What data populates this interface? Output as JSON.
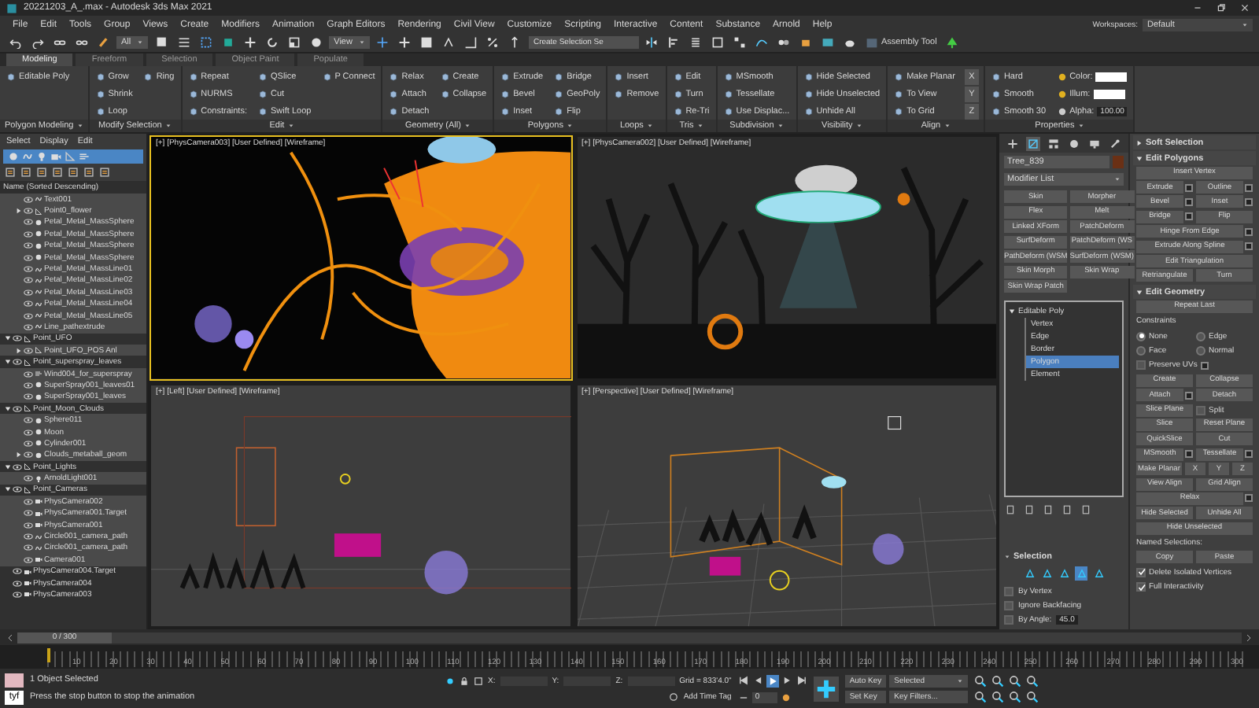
{
  "window": {
    "title": "20221203_A_.max - Autodesk 3ds Max 2021"
  },
  "menu": [
    "File",
    "Edit",
    "Tools",
    "Group",
    "Views",
    "Create",
    "Modifiers",
    "Animation",
    "Graph Editors",
    "Rendering",
    "Civil View",
    "Customize",
    "Scripting",
    "Interactive",
    "Content",
    "Substance",
    "Arnold",
    "Help"
  ],
  "workspaces": {
    "label": "Workspaces:",
    "value": "Default"
  },
  "toolbar": {
    "selection_filter": "All",
    "coordinate_system": "View",
    "named_selection_placeholder": "Create Selection Se",
    "assembly_tool": "Assembly Tool"
  },
  "ribbon_tabs": [
    {
      "label": "Modeling",
      "selected": true
    },
    {
      "label": "Freeform",
      "selected": false
    },
    {
      "label": "Selection",
      "selected": false
    },
    {
      "label": "Object Paint",
      "selected": false
    },
    {
      "label": "Populate",
      "selected": false
    }
  ],
  "ribbon_panels": [
    {
      "title": "Polygon Modeling",
      "items": [
        {
          "label": "Editable Poly"
        }
      ]
    },
    {
      "title": "Modify Selection",
      "items": [
        {
          "label": "Grow"
        },
        {
          "label": "Shrink"
        },
        {
          "label": "Loop"
        },
        {
          "label": "Ring"
        }
      ]
    },
    {
      "title": "Edit",
      "items": [
        {
          "label": "Repeat"
        },
        {
          "label": "NURMS"
        },
        {
          "label": "Constraints:"
        },
        {
          "label": "QSlice"
        },
        {
          "label": "Cut"
        },
        {
          "label": "Swift Loop"
        },
        {
          "label": "P Connect"
        }
      ]
    },
    {
      "title": "Geometry (All)",
      "items": [
        {
          "label": "Relax"
        },
        {
          "label": "Attach"
        },
        {
          "label": "Detach"
        },
        {
          "label": "Create"
        },
        {
          "label": "Collapse"
        }
      ]
    },
    {
      "title": "Polygons",
      "items": [
        {
          "label": "Extrude"
        },
        {
          "label": "Bevel"
        },
        {
          "label": "Inset"
        },
        {
          "label": "Bridge"
        },
        {
          "label": "GeoPoly"
        },
        {
          "label": "Flip"
        }
      ]
    },
    {
      "title": "Loops",
      "items": [
        {
          "label": "Insert"
        },
        {
          "label": "Remove"
        }
      ]
    },
    {
      "title": "Tris",
      "items": [
        {
          "label": "Edit"
        },
        {
          "label": "Turn"
        },
        {
          "label": "Re-Tri"
        }
      ]
    },
    {
      "title": "Subdivision",
      "items": [
        {
          "label": "MSmooth"
        },
        {
          "label": "Tessellate"
        },
        {
          "label": "Use Displac..."
        }
      ]
    },
    {
      "title": "Visibility",
      "items": [
        {
          "label": "Hide Selected"
        },
        {
          "label": "Hide Unselected"
        },
        {
          "label": "Unhide All"
        }
      ]
    },
    {
      "title": "Align",
      "items": [
        {
          "label": "Make Planar"
        },
        {
          "label": "To View"
        },
        {
          "label": "To Grid"
        },
        {
          "label": "X",
          "kind": "axis"
        },
        {
          "label": "Y",
          "kind": "axis"
        },
        {
          "label": "Z",
          "kind": "axis"
        }
      ]
    },
    {
      "title": "Properties",
      "items": [
        {
          "label": "Hard"
        },
        {
          "label": "Smooth"
        },
        {
          "label": "Smooth 30"
        },
        {
          "label": "Color:",
          "kind": "swatch"
        },
        {
          "label": "Illum:",
          "kind": "swatch"
        },
        {
          "label": "Alpha:",
          "kind": "number",
          "value": "100.00"
        }
      ]
    }
  ],
  "scene_explorer": {
    "tabs": [
      "Select",
      "Display",
      "Edit"
    ],
    "header": "Name (Sorted Descending)",
    "continued_children": [
      {
        "name": "Text001",
        "kind": "shape"
      },
      {
        "name": "Point0_flower",
        "kind": "helper",
        "expanded": false
      },
      {
        "name": "Petal_Metal_MassSphere",
        "kind": "geometry"
      },
      {
        "name": "Petal_Metal_MassSphere",
        "kind": "geometry"
      },
      {
        "name": "Petal_Metal_MassSphere",
        "kind": "geometry"
      },
      {
        "name": "Petal_Metal_MassSphere",
        "kind": "geometry"
      },
      {
        "name": "Petal_Metal_MassLine01",
        "kind": "shape"
      },
      {
        "name": "Petal_Metal_MassLine02",
        "kind": "shape"
      },
      {
        "name": "Petal_Metal_MassLine03",
        "kind": "shape"
      },
      {
        "name": "Petal_Metal_MassLine04",
        "kind": "shape"
      },
      {
        "name": "Petal_Metal_MassLine05",
        "kind": "shape"
      },
      {
        "name": "Line_pathextrude",
        "kind": "shape"
      }
    ],
    "roots": [
      {
        "name": "Point_UFO",
        "kind": "helper",
        "expanded": true,
        "children": [
          {
            "name": "Point_UFO_POS Anl",
            "kind": "helper",
            "expanded": false
          }
        ]
      },
      {
        "name": "Point_superspray_leaves",
        "kind": "helper",
        "expanded": true,
        "children": [
          {
            "name": "Wind004_for_superspray",
            "kind": "particles"
          },
          {
            "name": "SuperSpray001_leaves01",
            "kind": "geometry"
          },
          {
            "name": "SuperSpray001_leaves",
            "kind": "geometry"
          }
        ]
      },
      {
        "name": "Point_Moon_Clouds",
        "kind": "helper",
        "expanded": true,
        "children": [
          {
            "name": "Sphere011",
            "kind": "geometry"
          },
          {
            "name": "Moon",
            "kind": "geometry"
          },
          {
            "name": "Cylinder001",
            "kind": "geometry"
          },
          {
            "name": "Clouds_metaball_geom",
            "kind": "geometry",
            "expanded": false
          }
        ]
      },
      {
        "name": "Point_Lights",
        "kind": "helper",
        "expanded": true,
        "children": [
          {
            "name": "ArnoldLight001",
            "kind": "light"
          }
        ]
      },
      {
        "name": "Point_Cameras",
        "kind": "helper",
        "expanded": true,
        "children": [
          {
            "name": "PhysCamera002",
            "kind": "camera"
          },
          {
            "name": "PhysCamera001.Target",
            "kind": "camera"
          },
          {
            "name": "PhysCamera001",
            "kind": "camera"
          },
          {
            "name": "Circle001_camera_path",
            "kind": "shape"
          },
          {
            "name": "Circle001_camera_path",
            "kind": "shape"
          },
          {
            "name": "Camera001",
            "kind": "camera"
          }
        ]
      },
      {
        "name": "PhysCamera004.Target",
        "kind": "camera"
      },
      {
        "name": "PhysCamera004",
        "kind": "camera"
      },
      {
        "name": "PhysCamera003",
        "kind": "camera"
      }
    ]
  },
  "viewports": [
    {
      "label": "[+] [PhysCamera003] [User Defined] [Wireframe]",
      "kind": "render",
      "active": true
    },
    {
      "label": "[+] [PhysCamera002] [User Defined] [Wireframe]",
      "kind": "night",
      "active": false
    },
    {
      "label": "[+] [Left] [User Defined] [Wireframe]",
      "kind": "side",
      "active": false
    },
    {
      "label": "[+] [Perspective] [User Defined] [Wireframe]",
      "kind": "perspective",
      "active": false
    }
  ],
  "command_panel": {
    "tabs": [
      {
        "selected": false
      },
      {
        "selected": true
      },
      {
        "selected": false
      },
      {
        "selected": false
      },
      {
        "selected": false
      },
      {
        "selected": false
      }
    ],
    "object_name": "Tree_839",
    "modifier_list": "Modifier List",
    "modifier_buttons": [
      "Skin",
      "Morpher",
      "Flex",
      "Melt",
      "Linked XForm",
      "PatchDeform",
      "SurfDeform",
      "PatchDeform (WS",
      "PathDeform (WSM",
      "SurfDeform (WSM)",
      "Skin Morph",
      "Skin Wrap",
      "Skin Wrap Patch"
    ],
    "modifier_stack": {
      "name": "Editable Poly",
      "expanded": true,
      "levels": [
        {
          "label": "Vertex",
          "selected": false
        },
        {
          "label": "Edge",
          "selected": false
        },
        {
          "label": "Border",
          "selected": false
        },
        {
          "label": "Polygon",
          "selected": true
        },
        {
          "label": "Element",
          "selected": false
        }
      ]
    },
    "selection_rollout": {
      "title": "Selection",
      "options": [
        {
          "label": "By Vertex",
          "checked": false
        },
        {
          "label": "Ignore Backfacing",
          "checked": false
        },
        {
          "label": "By Angle:",
          "checked": false,
          "value": "45.0"
        }
      ]
    },
    "rollouts": [
      {
        "title": "Soft Selection",
        "expanded": false
      },
      {
        "title": "Edit Polygons",
        "expanded": true,
        "rows": [
          [
            {
              "label": "Insert Vertex"
            }
          ],
          [
            {
              "label": "Extrude",
              "settings": true
            },
            {
              "label": "Outline",
              "settings": true
            }
          ],
          [
            {
              "label": "Bevel",
              "settings": true
            },
            {
              "label": "Inset",
              "settings": true
            }
          ],
          [
            {
              "label": "Bridge",
              "settings": true
            },
            {
              "label": "Flip"
            }
          ],
          [
            {
              "label": "Hinge From Edge",
              "settings": true
            }
          ],
          [
            {
              "label": "Extrude Along Spline",
              "settings": true
            }
          ],
          [
            {
              "label": "Edit Triangulation"
            }
          ],
          [
            {
              "label": "Retriangulate"
            },
            {
              "label": "Turn"
            }
          ]
        ]
      },
      {
        "title": "Edit Geometry",
        "expanded": true,
        "rows": [
          [
            {
              "label": "Repeat Last"
            }
          ],
          [
            {
              "label": "Constraints",
              "kind": "label"
            }
          ],
          [
            {
              "label": "None",
              "kind": "radio",
              "checked": true
            },
            {
              "label": "Edge",
              "kind": "radio",
              "checked": false
            }
          ],
          [
            {
              "label": "Face",
              "kind": "radio",
              "checked": false
            },
            {
              "label": "Normal",
              "kind": "radio",
              "checked": false
            }
          ],
          [
            {
              "label": "Preserve UVs",
              "kind": "checkbox",
              "checked": false,
              "settings": true
            }
          ],
          [
            {
              "label": "Create"
            },
            {
              "label": "Collapse"
            }
          ],
          [
            {
              "label": "Attach",
              "settings": true
            },
            {
              "label": "Detach"
            }
          ],
          [
            {
              "label": "Slice Plane"
            },
            {
              "label": "Split",
              "kind": "checkbox",
              "checked": false
            }
          ],
          [
            {
              "label": "Slice"
            },
            {
              "label": "Reset Plane"
            }
          ],
          [
            {
              "label": "QuickSlice"
            },
            {
              "label": "Cut"
            }
          ],
          [
            {
              "label": "MSmooth",
              "settings": true
            },
            {
              "label": "Tessellate",
              "settings": true
            }
          ],
          [
            {
              "label": "Make Planar"
            },
            {
              "label": "X"
            },
            {
              "label": "Y"
            },
            {
              "label": "Z"
            }
          ],
          [
            {
              "label": "View Align"
            },
            {
              "label": "Grid Align"
            }
          ],
          [
            {
              "label": "Relax",
              "settings": true
            }
          ],
          [
            {
              "label": "Hide Selected"
            },
            {
              "label": "Unhide All"
            }
          ],
          [
            {
              "label": "Hide Unselected"
            }
          ],
          [
            {
              "label": "Named Selections:",
              "kind": "label"
            }
          ],
          [
            {
              "label": "Copy"
            },
            {
              "label": "Paste"
            }
          ],
          [
            {
              "label": "Delete Isolated Vertices",
              "kind": "checkbox",
              "checked": true
            }
          ],
          [
            {
              "label": "Full Interactivity",
              "kind": "checkbox",
              "checked": true
            }
          ]
        ]
      }
    ]
  },
  "time_slider": {
    "label": "0 / 300",
    "level": 0
  },
  "timeline_ticks": [
    "10",
    "20",
    "30",
    "40",
    "50",
    "60",
    "70",
    "80",
    "90",
    "100",
    "110",
    "120",
    "130",
    "140",
    "150",
    "160",
    "170",
    "180",
    "190",
    "200",
    "210",
    "220",
    "230",
    "240",
    "250",
    "260",
    "270",
    "280",
    "290",
    "300"
  ],
  "status": {
    "selection": "1 Object Selected",
    "prompt": "Press the stop button to stop the animation",
    "script_label": "tyf",
    "x_label": "X:",
    "y_label": "Y:",
    "z_label": "Z:",
    "grid": "Grid = 833'4.0\"",
    "add_time_tag": "Add Time Tag",
    "frame": "0",
    "auto_key": "Auto Key",
    "key_mode": "Selected",
    "set_key": "Set Key",
    "key_filters": "Key Filters..."
  }
}
